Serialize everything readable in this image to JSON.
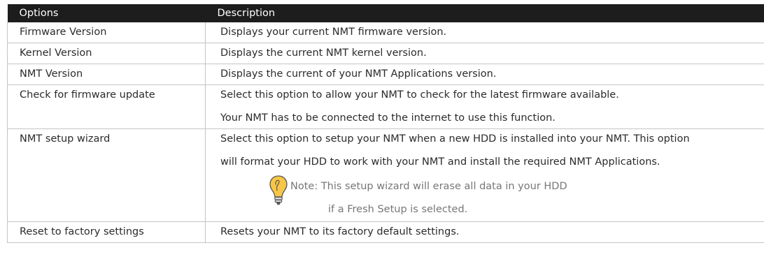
{
  "table": {
    "headers": [
      "Options",
      "Description"
    ],
    "rows": [
      {
        "option": "Firmware Version",
        "description": [
          "Displays your current NMT firmware version."
        ]
      },
      {
        "option": "Kernel Version",
        "description": [
          "Displays the current NMT kernel version."
        ]
      },
      {
        "option": "NMT Version",
        "description": [
          "Displays the current of your NMT Applications version."
        ]
      },
      {
        "option": "Check for firmware update",
        "description": [
          "Select this option to allow your NMT to check for the latest firmware available.",
          "Your NMT has to be connected to the internet to use this function."
        ]
      },
      {
        "option": "NMT setup wizard",
        "description": [
          "Select this option to setup your NMT when a new HDD is installed into your NMT. This option",
          "will format your HDD to work with your NMT and install the required NMT Applications."
        ],
        "note": {
          "icon": "lightbulb-icon",
          "line1": "Note: This setup wizard will erase all data in your HDD",
          "line2": "if a Fresh Setup is selected."
        }
      },
      {
        "option": "Reset to factory settings",
        "description": [
          "Resets your NMT to its factory default settings."
        ]
      }
    ]
  },
  "colors": {
    "header_bg": "#1d1d1d",
    "header_text": "#ffffff",
    "border": "#c4c4c4",
    "note_text": "#777777",
    "bulb_fill": "#f8c646"
  }
}
